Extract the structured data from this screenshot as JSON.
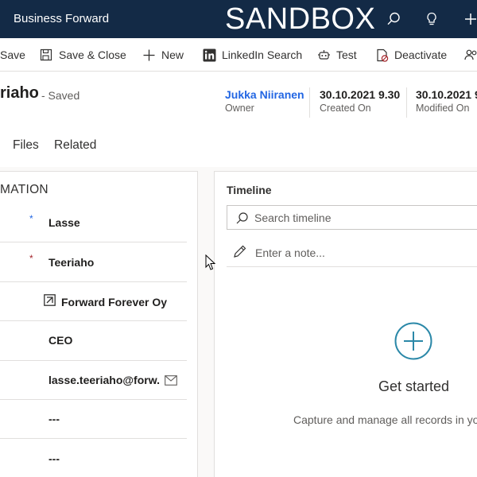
{
  "header": {
    "app_title": "Business Forward",
    "environment_banner": "SANDBOX",
    "icons": [
      "search-icon",
      "lightbulb-icon",
      "plus-icon"
    ]
  },
  "command_bar": {
    "items": [
      {
        "label": "Save",
        "icon": "save-icon"
      },
      {
        "label": "Save & Close",
        "icon": "save-close-icon"
      },
      {
        "label": "New",
        "icon": "plus-icon"
      },
      {
        "label": "LinkedIn Search",
        "icon": "linkedin-icon"
      },
      {
        "label": "Test",
        "icon": "robot-icon"
      },
      {
        "label": "Deactivate",
        "icon": "deactivate-icon"
      }
    ]
  },
  "record": {
    "name": "riaho",
    "status": "- Saved",
    "owner": {
      "value": "Jukka Niiranen",
      "label": "Owner"
    },
    "created_on": {
      "value": "30.10.2021 9.30",
      "label": "Created On"
    },
    "modified_on": {
      "value": "30.10.2021 9",
      "label": "Modified On"
    }
  },
  "tabs": [
    {
      "label": "Files"
    },
    {
      "label": "Related"
    }
  ],
  "section": {
    "title": "MATION",
    "fields": [
      {
        "value": "Lasse",
        "required": "recommended"
      },
      {
        "value": "Teeriaho",
        "required": "required"
      },
      {
        "value": "Forward Forever Oy",
        "lookup": true
      },
      {
        "value": "CEO"
      },
      {
        "value": "lasse.teeriaho@forw...",
        "email": true
      },
      {
        "value": "---"
      },
      {
        "value": "---"
      }
    ]
  },
  "timeline": {
    "title": "Timeline",
    "search_placeholder": "Search timeline",
    "note_placeholder": "Enter a note...",
    "get_started": "Get started",
    "capture_text": "Capture and manage all records in yo"
  },
  "colors": {
    "header_bg": "#132a46",
    "link": "#2266e3",
    "required": "#a4262c",
    "accent_teal": "#2b88a8"
  }
}
